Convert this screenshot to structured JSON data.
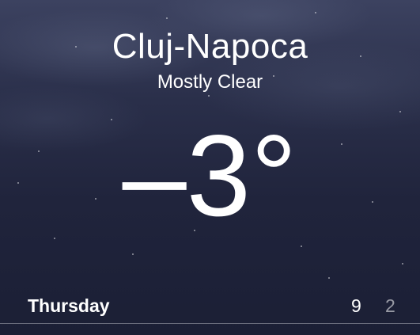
{
  "location": {
    "city": "Cluj-Napoca",
    "condition": "Mostly Clear",
    "temperature": "–3°"
  },
  "forecast_today": {
    "day": "Thursday",
    "high": "9",
    "low": "2"
  },
  "theme": {
    "text_color": "#ffffff",
    "background_top": "#3c4260",
    "background_bottom": "#1b1f35"
  }
}
